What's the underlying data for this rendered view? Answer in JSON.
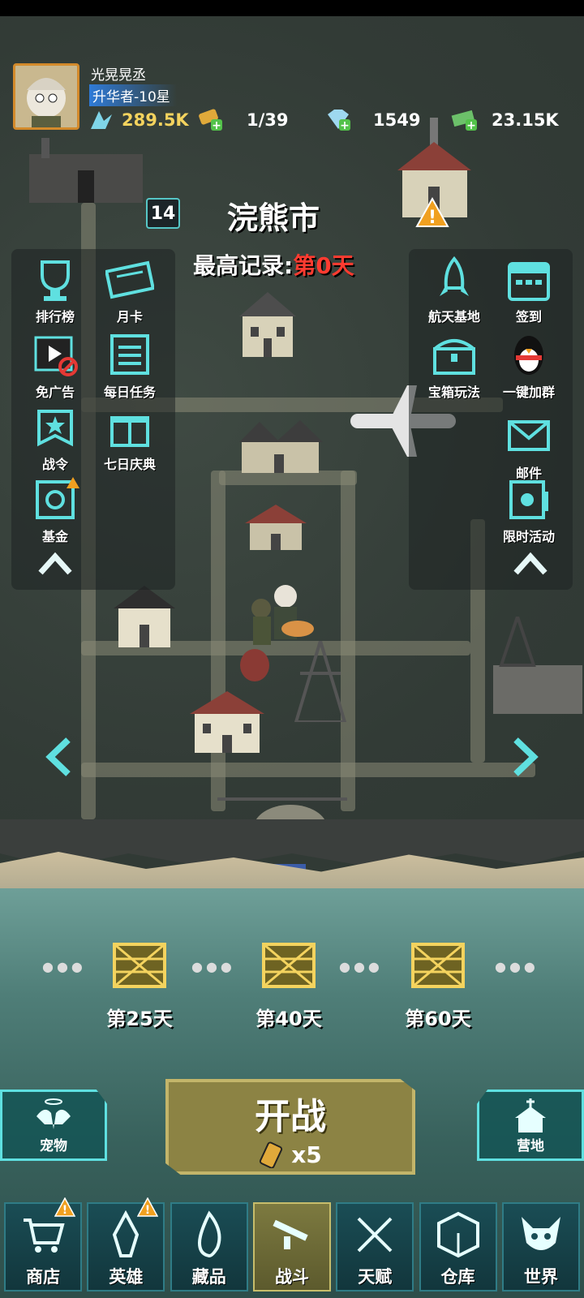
{
  "player": {
    "name": "光晃晃丞",
    "rank": "升华者-10星"
  },
  "resources": {
    "power": "289.5K",
    "energy": "1/39",
    "diamonds": "1549",
    "cash": "23.15K"
  },
  "city": {
    "level": "14",
    "name": "浣熊市",
    "record_label": "最高记录:",
    "record_value": "第0天"
  },
  "left_features": [
    {
      "label": "排行榜",
      "icon": "trophy-icon"
    },
    {
      "label": "月卡",
      "icon": "ticket-icon"
    },
    {
      "label": "免广告",
      "icon": "no-ads-icon"
    },
    {
      "label": "每日任务",
      "icon": "task-list-icon"
    },
    {
      "label": "战令",
      "icon": "banner-icon"
    },
    {
      "label": "七日庆典",
      "icon": "gift-icon"
    },
    {
      "label": "基金",
      "icon": "safe-icon"
    }
  ],
  "right_features": [
    {
      "label": "航天基地",
      "icon": "rocket-icon"
    },
    {
      "label": "签到",
      "icon": "calendar-icon"
    },
    {
      "label": "宝箱玩法",
      "icon": "chest-icon"
    },
    {
      "label": "一键加群",
      "icon": "penguin-icon"
    },
    {
      "label": "邮件",
      "icon": "mail-icon"
    },
    {
      "label": "限时活动",
      "icon": "event-icon"
    }
  ],
  "milestones": [
    {
      "label": "第25天"
    },
    {
      "label": "第40天"
    },
    {
      "label": "第60天"
    }
  ],
  "battle": {
    "title": "开战",
    "cost": "x5"
  },
  "side_buttons": {
    "pet": "宠物",
    "camp": "营地"
  },
  "nav": [
    {
      "label": "商店",
      "icon": "cart-icon",
      "warning": true
    },
    {
      "label": "英雄",
      "icon": "hero-icon",
      "warning": true
    },
    {
      "label": "藏品",
      "icon": "flame-icon",
      "warning": false
    },
    {
      "label": "战斗",
      "icon": "rifle-icon",
      "warning": false,
      "active": true
    },
    {
      "label": "天赋",
      "icon": "dna-icon",
      "warning": false
    },
    {
      "label": "仓库",
      "icon": "box-icon",
      "warning": false
    },
    {
      "label": "世界",
      "icon": "monster-icon",
      "warning": false
    }
  ],
  "colors": {
    "accent_cyan": "#5fe0e0",
    "record_red": "#ff3b30",
    "power_gold": "#f4d35e",
    "battle_olive": "#8c8344"
  }
}
